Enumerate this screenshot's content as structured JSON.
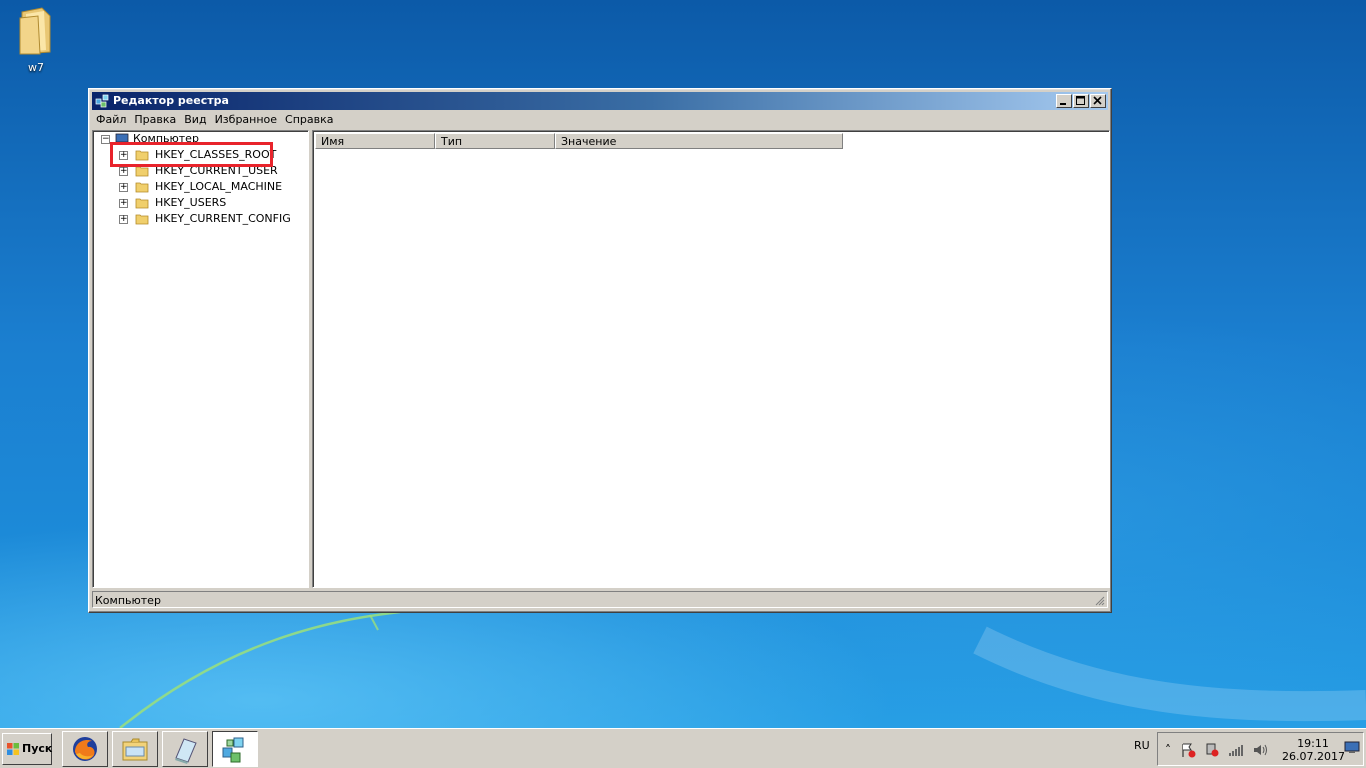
{
  "desktop": {
    "icons": [
      {
        "label": "w7",
        "icon": "folder-icon"
      }
    ]
  },
  "window": {
    "title": "Редактор реестра",
    "menu": [
      "Файл",
      "Правка",
      "Вид",
      "Избранное",
      "Справка"
    ],
    "tree": {
      "root": "Компьютер",
      "keys": [
        "HKEY_CLASSES_ROOT",
        "HKEY_CURRENT_USER",
        "HKEY_LOCAL_MACHINE",
        "HKEY_USERS",
        "HKEY_CURRENT_CONFIG"
      ]
    },
    "columns": [
      "Имя",
      "Тип",
      "Значение"
    ],
    "status": "Компьютер"
  },
  "highlight": {
    "color": "#e8232b",
    "target": "HKEY_CLASSES_ROOT"
  },
  "taskbar": {
    "start_label": "Пуск",
    "apps": [
      "firefox-icon",
      "explorer-icon",
      "notepad-icon",
      "regedit-icon"
    ],
    "language": "RU",
    "time": "19:11",
    "date": "26.07.2017"
  }
}
